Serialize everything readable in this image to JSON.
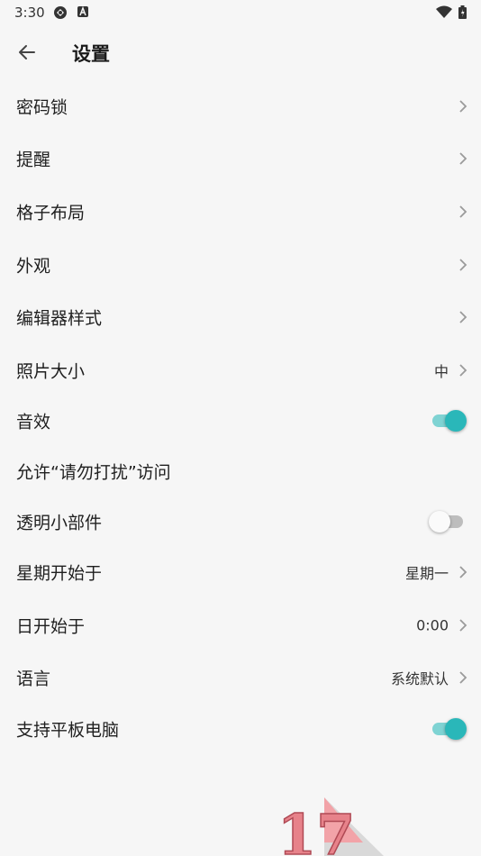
{
  "status_bar": {
    "time": "3:30",
    "icons": [
      "sync-icon",
      "a-badge-icon",
      "wifi-icon",
      "battery-icon"
    ]
  },
  "app_bar": {
    "back_icon": "arrow-left-icon",
    "title": "设置"
  },
  "settings": {
    "passcode": {
      "label": "密码锁"
    },
    "reminder": {
      "label": "提醒"
    },
    "grid_layout": {
      "label": "格子布局"
    },
    "appearance": {
      "label": "外观"
    },
    "editor_style": {
      "label": "编辑器样式"
    },
    "photo_size": {
      "label": "照片大小",
      "value": "中"
    },
    "sound_effects": {
      "label": "音效",
      "enabled": true
    },
    "dnd_access": {
      "label": "允许“请勿打扰”访问"
    },
    "transparent_widget": {
      "label": "透明小部件",
      "enabled": false
    },
    "week_start": {
      "label": "星期开始于",
      "value": "星期一"
    },
    "day_start": {
      "label": "日开始于",
      "value": "0:00"
    },
    "language": {
      "label": "语言",
      "value": "系统默认"
    },
    "tablet_support": {
      "label": "支持平板电脑",
      "enabled": true
    }
  },
  "colors": {
    "accent": "#2ab7b9",
    "accent_track": "#7fd3d3",
    "background": "#f6f6f6",
    "text": "#1f1f1f"
  },
  "watermark": {
    "text": "17"
  }
}
